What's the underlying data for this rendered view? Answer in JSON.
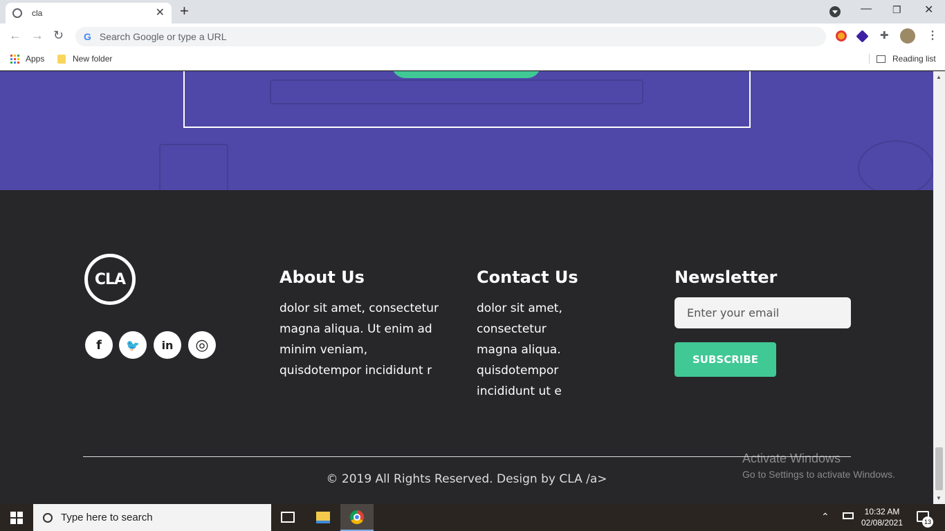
{
  "browser": {
    "tab_title": "cla",
    "new_tab": "+",
    "omnibox_placeholder": "Search Google or type a URL",
    "omnibox_g": "G",
    "bookmarks": {
      "apps": "Apps",
      "folder": "New folder",
      "reading_list": "Reading list"
    }
  },
  "hero": {
    "accent": "#4f48a8",
    "button_color": "#40c895"
  },
  "footer": {
    "logo": "CLA",
    "social": [
      {
        "icon": "facebook-icon",
        "glyph": "f"
      },
      {
        "icon": "twitter-icon",
        "glyph": "🐦"
      },
      {
        "icon": "linkedin-icon",
        "glyph": "in"
      },
      {
        "icon": "instagram-icon",
        "glyph": "◎"
      }
    ],
    "about": {
      "title": "About Us",
      "lines": [
        "dolor sit amet, consectetur",
        "magna aliqua. Ut enim ad",
        "minim veniam,",
        "quisdotempor incididunt r"
      ]
    },
    "contact": {
      "title": "Contact Us",
      "lines": [
        "dolor sit amet,",
        "consectetur",
        "magna aliqua.",
        "quisdotempor",
        "incididunt ut e"
      ]
    },
    "newsletter": {
      "title": "Newsletter",
      "placeholder": "Enter your email",
      "button": "SUBSCRIBE"
    },
    "copyright": "© 2019 All Rights Reserved. Design by CLA /a>",
    "background": "#272629"
  },
  "watermark": {
    "line1": "Activate Windows",
    "line2": "Go to Settings to activate Windows."
  },
  "taskbar": {
    "search_placeholder": "Type here to search",
    "time": "10:32 AM",
    "date": "02/08/2021",
    "notification_count": "13"
  }
}
